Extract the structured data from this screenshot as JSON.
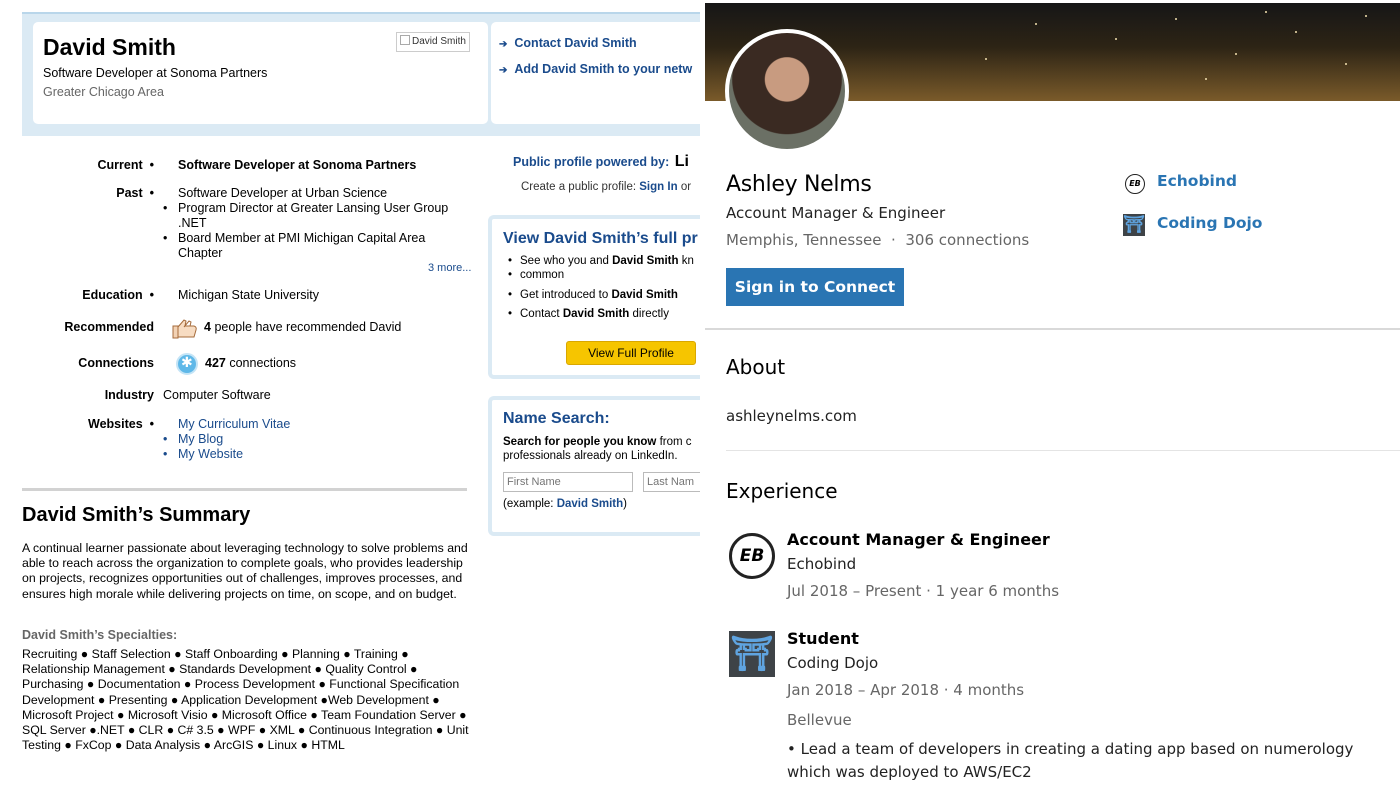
{
  "left_profile": {
    "name": "David Smith",
    "headline": "Software Developer at Sonoma Partners",
    "location": "Greater Chicago Area",
    "photo_alt": "David Smith",
    "actions": [
      "Contact David Smith",
      "Add David Smith to your netw"
    ],
    "rows": {
      "current_label": "Current",
      "current": "Software Developer at Sonoma Partners",
      "past_label": "Past",
      "past": [
        "Software Developer at Urban Science",
        "Program Director at Greater Lansing User Group",
        ".NET",
        "Board Member at PMI Michigan Capital Area",
        "Chapter"
      ],
      "more_link": "3 more...",
      "education_label": "Education",
      "education": "Michigan State University",
      "recommended_label": "Recommended",
      "recommended_count": "4",
      "recommended_text": "people have recommended David",
      "connections_label": "Connections",
      "connections_count": "427",
      "connections_text": "connections",
      "industry_label": "Industry",
      "industry": "Computer Software",
      "websites_label": "Websites",
      "websites": [
        "My Curriculum Vitae",
        "My Blog",
        "My Website"
      ]
    },
    "summary_title": "David Smith’s Summary",
    "summary": "A continual learner passionate about leveraging technology to solve problems and able to reach across the organization to complete goals, who provides leadership on projects, recognizes opportunities out of challenges, improves processes, and ensures high morale while delivering projects on time, on scope, and on budget.",
    "specialties_title": "David Smith’s Specialties:",
    "specialties": "Recruiting ● Staff Selection ● Staff Onboarding ● Planning ● Training ● Relationship Management ● Standards Development ● Quality Control ● Purchasing ● Documentation ● Process Development ● Functional Specification Development ● Presenting ● Application Development ●Web Development ● Microsoft Project ● Microsoft Visio ● Microsoft Office ● Team Foundation Server ● SQL Server ●.NET ● CLR ● C# 3.5 ● WPF ● XML ● Continuous Integration ● Unit Testing ● FxCop ● Data Analysis ● ArcGIS ● Linux ● HTML",
    "public_profile": {
      "label": "Public profile powered by:",
      "brand": "Li",
      "create_text": "Create a public profile:",
      "sign_in": "Sign In",
      "or": "or"
    },
    "full_profile": {
      "title": "View David Smith’s full pr",
      "item1_a": "See who you and",
      "item1_b": "David Smith",
      "item1_c": "kn",
      "item1_line2": "common",
      "item2_a": "Get introduced to",
      "item2_b": "David Smith",
      "item3_a": "Contact",
      "item3_b": "David Smith",
      "item3_c": "directly",
      "button": "View Full Profile"
    },
    "name_search": {
      "title": "Name Search:",
      "line1_bold": "Search for people you know",
      "line1_rest": "from c",
      "line2": "professionals already on LinkedIn.",
      "first_placeholder": "First Name",
      "last_placeholder": "Last Nam",
      "example_prefix": "(example:",
      "example_name": "David Smith",
      "example_suffix": ")"
    }
  },
  "right_profile": {
    "name": "Ashley Nelms",
    "headline": "Account Manager & Engineer",
    "location": "Memphis, Tennessee",
    "connections": "306 connections",
    "companies": [
      "Echobind",
      "Coding Dojo"
    ],
    "connect_button": "Sign in to Connect",
    "about_title": "About",
    "about_text": "ashleynelms.com",
    "experience_title": "Experience",
    "experience": [
      {
        "title": "Account Manager & Engineer",
        "company": "Echobind",
        "dates": "Jul 2018 – Present · 1 year 6 months"
      },
      {
        "title": "Student",
        "company": "Coding Dojo",
        "dates": "Jan 2018 – Apr 2018 · 4 months",
        "location": "Bellevue",
        "description": "• Lead a team of developers in creating a dating app based on numerology which was deployed to AWS/EC2"
      }
    ]
  }
}
